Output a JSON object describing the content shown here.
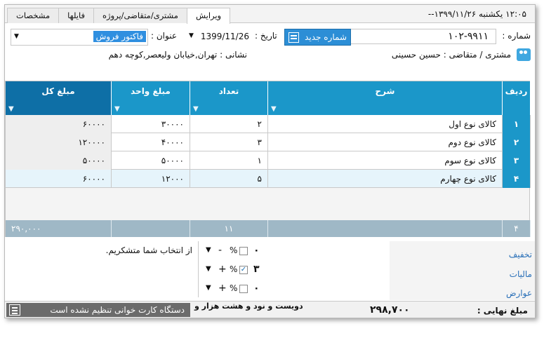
{
  "clock": "۱۲:۰۵  یکشنبه  ۱۳۹۹/۱۱/۲۶--",
  "tabs": [
    "ویرایش",
    "مشتری/متقاضی/پروژه",
    "فایلها",
    "مشخصات"
  ],
  "header": {
    "number_label": "شماره :",
    "number_value": "۱۰۲-۹۹۱۱",
    "new_number_button": "شماره جدید",
    "date_label": "تاریخ :",
    "date_value": "1399/11/26",
    "title_label": "عنوان :",
    "title_value": "فاکتور فروش",
    "customer": "مشتری / متقاضی :  حسین حسینی",
    "address": "نشانی : تهران,خیابان ولیعصر,کوچه دهم"
  },
  "grid": {
    "columns": [
      "ردیف",
      "شرح",
      "تعداد",
      "مبلغ واحد",
      "مبلغ کل"
    ],
    "rows": [
      {
        "n": "۱",
        "desc": "کالای نوع اول",
        "qty": "۲",
        "unit": "۳۰۰۰۰",
        "total": "۶۰۰۰۰"
      },
      {
        "n": "۲",
        "desc": "کالای نوع دوم",
        "qty": "۳",
        "unit": "۴۰۰۰۰",
        "total": "۱۲۰۰۰۰"
      },
      {
        "n": "۳",
        "desc": "کالای نوع سوم",
        "qty": "۱",
        "unit": "۵۰۰۰۰",
        "total": "۵۰۰۰۰"
      },
      {
        "n": "۴",
        "desc": "کالای نوع چهارم",
        "qty": "۵",
        "unit": "۱۲۰۰۰",
        "total": "۶۰۰۰۰"
      }
    ],
    "footer": {
      "count": "۴",
      "qty_total": "۱۱",
      "sum_total": "۲۹۰,۰۰۰"
    }
  },
  "note": "از انتخاب شما متشکریم.",
  "adjustments": [
    {
      "label": "تخفیف",
      "sign": "-",
      "pct": "%",
      "checked": "",
      "value": "۰"
    },
    {
      "label": "مالیات",
      "sign": "+",
      "pct": "%",
      "checked": "✓",
      "value": "۳"
    },
    {
      "label": "عوارض",
      "sign": "+",
      "pct": "%",
      "checked": "",
      "value": "۰"
    }
  ],
  "footer_bar": {
    "card_reader": "دستگاه کارت خوانی تنظیم نشده است",
    "total_words": "دویست و نود و هشت هزار و",
    "final_label": "مبلغ نهایی :",
    "final_value": "۲۹۸,۷۰۰"
  }
}
